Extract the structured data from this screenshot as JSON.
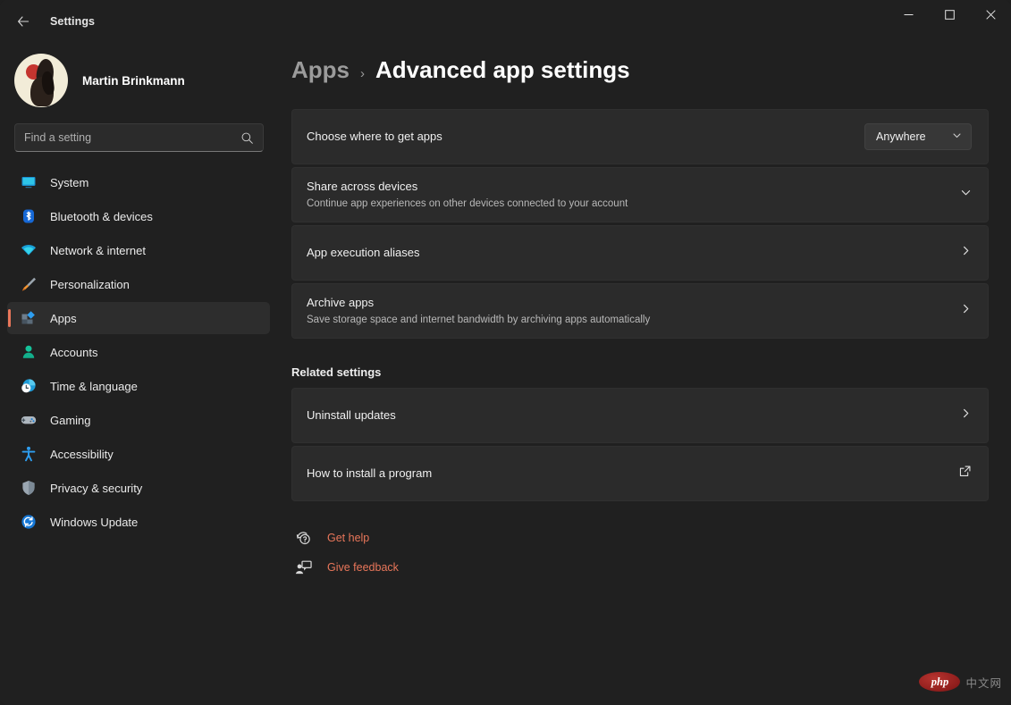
{
  "window": {
    "title": "Settings",
    "back_icon": "back-arrow-icon",
    "minimize_label": "—",
    "maximize_label": "☐",
    "close_label": "✕"
  },
  "sidebar": {
    "profile": {
      "name": "Martin Brinkmann",
      "avatar_icon": "user-avatar"
    },
    "search": {
      "placeholder": "Find a setting",
      "value": "",
      "icon": "search-icon"
    },
    "items": [
      {
        "label": "System",
        "icon": "monitor-icon",
        "selected": false
      },
      {
        "label": "Bluetooth & devices",
        "icon": "bluetooth-icon",
        "selected": false
      },
      {
        "label": "Network & internet",
        "icon": "wifi-icon",
        "selected": false
      },
      {
        "label": "Personalization",
        "icon": "paintbrush-icon",
        "selected": false
      },
      {
        "label": "Apps",
        "icon": "apps-icon",
        "selected": true
      },
      {
        "label": "Accounts",
        "icon": "person-icon",
        "selected": false
      },
      {
        "label": "Time & language",
        "icon": "clock-globe-icon",
        "selected": false
      },
      {
        "label": "Gaming",
        "icon": "gamepad-icon",
        "selected": false
      },
      {
        "label": "Accessibility",
        "icon": "accessibility-icon",
        "selected": false
      },
      {
        "label": "Privacy & security",
        "icon": "shield-icon",
        "selected": false
      },
      {
        "label": "Windows Update",
        "icon": "update-icon",
        "selected": false
      }
    ]
  },
  "main": {
    "breadcrumb": {
      "parent": "Apps",
      "separator": "›",
      "current": "Advanced app settings"
    },
    "cards": [
      {
        "title": "Choose where to get apps",
        "subtitle": "",
        "control": "dropdown",
        "dropdown_value": "Anywhere",
        "dropdown_icon": "chevron-down-icon"
      },
      {
        "title": "Share across devices",
        "subtitle": "Continue app experiences on other devices connected to your account",
        "control": "expander",
        "control_icon": "chevron-down-icon"
      },
      {
        "title": "App execution aliases",
        "subtitle": "",
        "control": "navigate",
        "control_icon": "chevron-right-icon"
      },
      {
        "title": "Archive apps",
        "subtitle": "Save storage space and internet bandwidth by archiving apps automatically",
        "control": "navigate",
        "control_icon": "chevron-right-icon"
      }
    ],
    "related_settings": {
      "heading": "Related settings",
      "cards": [
        {
          "title": "Uninstall updates",
          "subtitle": "",
          "control": "navigate",
          "control_icon": "chevron-right-icon"
        },
        {
          "title": "How to install a program",
          "subtitle": "",
          "control": "external",
          "control_icon": "external-link-icon"
        }
      ]
    },
    "footer_links": [
      {
        "label": "Get help",
        "icon": "help-icon"
      },
      {
        "label": "Give feedback",
        "icon": "feedback-icon"
      }
    ]
  },
  "watermark": {
    "logo_text": "php",
    "text": "中文网"
  },
  "colors": {
    "accent": "#e8765a",
    "card_bg": "#2b2b2b",
    "app_bg": "#202020",
    "selected_bg": "#2d2d2d"
  }
}
